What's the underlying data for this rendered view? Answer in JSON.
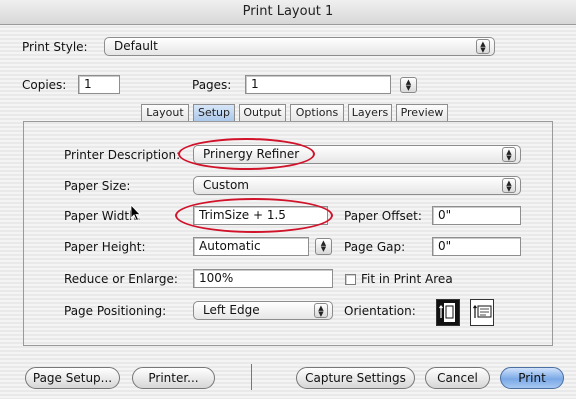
{
  "window": {
    "title": "Print Layout 1"
  },
  "print_style": {
    "label": "Print Style:",
    "value": "Default"
  },
  "copies": {
    "label": "Copies:",
    "value": "1"
  },
  "pages": {
    "label": "Pages:",
    "value": "1"
  },
  "tabs": [
    {
      "label": "Layout",
      "active": false
    },
    {
      "label": "Setup",
      "active": true
    },
    {
      "label": "Output",
      "active": false
    },
    {
      "label": "Options",
      "active": false
    },
    {
      "label": "Layers",
      "active": false
    },
    {
      "label": "Preview",
      "active": false
    }
  ],
  "setup": {
    "printer_description": {
      "label": "Printer Description:",
      "value": "Prinergy Refiner"
    },
    "paper_size": {
      "label": "Paper Size:",
      "value": "Custom"
    },
    "paper_width": {
      "label": "Paper Width:",
      "value": "TrimSize + 1.5"
    },
    "paper_offset": {
      "label": "Paper Offset:",
      "value": "0\""
    },
    "paper_height": {
      "label": "Paper Height:",
      "value": "Automatic"
    },
    "page_gap": {
      "label": "Page Gap:",
      "value": "0\""
    },
    "reduce_enlarge": {
      "label": "Reduce or Enlarge:",
      "value": "100%"
    },
    "fit_print_area": {
      "label": "Fit in Print Area",
      "checked": false
    },
    "page_positioning": {
      "label": "Page Positioning:",
      "value": "Left Edge"
    },
    "orientation": {
      "label": "Orientation:",
      "selected": "portrait"
    }
  },
  "buttons": {
    "page_setup": "Page Setup...",
    "printer": "Printer...",
    "capture_settings": "Capture Settings",
    "cancel": "Cancel",
    "print": "Print"
  },
  "colors": {
    "highlight_ovals": "#d0132a",
    "active_tab": "#a9c6ea",
    "default_button": "#7aa9e6"
  }
}
